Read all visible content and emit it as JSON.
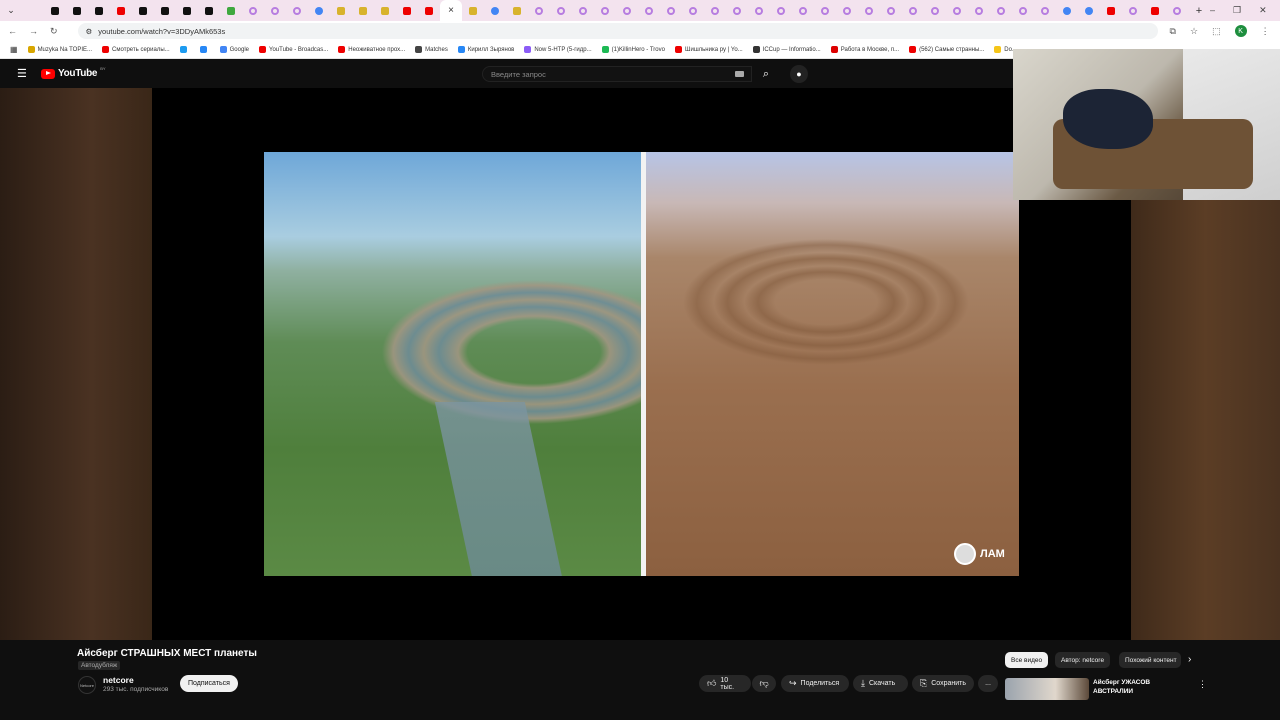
{
  "browser": {
    "url": "youtube.com/watch?v=3DDyAMk653s",
    "tabs": [
      {
        "icon": "chevron-down"
      },
      {
        "icon": "gear"
      },
      {
        "icon": "b"
      },
      {
        "icon": "b"
      },
      {
        "icon": "b"
      },
      {
        "icon": "r"
      },
      {
        "icon": "b"
      },
      {
        "icon": "b"
      },
      {
        "icon": "b"
      },
      {
        "icon": "b"
      },
      {
        "icon": "g"
      },
      {
        "icon": "p"
      },
      {
        "icon": "p"
      },
      {
        "icon": "p"
      },
      {
        "icon": "gg"
      },
      {
        "icon": "y"
      },
      {
        "icon": "y"
      },
      {
        "icon": "y"
      },
      {
        "icon": "r"
      },
      {
        "icon": "r"
      },
      {
        "icon": "close",
        "active": true
      },
      {
        "icon": "y"
      },
      {
        "icon": "gg"
      },
      {
        "icon": "y"
      },
      {
        "icon": "p"
      },
      {
        "icon": "p"
      },
      {
        "icon": "p"
      },
      {
        "icon": "p"
      },
      {
        "icon": "p"
      },
      {
        "icon": "p"
      },
      {
        "icon": "p"
      },
      {
        "icon": "p"
      },
      {
        "icon": "p"
      },
      {
        "icon": "p"
      },
      {
        "icon": "p"
      },
      {
        "icon": "p"
      },
      {
        "icon": "p"
      },
      {
        "icon": "p"
      },
      {
        "icon": "p"
      },
      {
        "icon": "p"
      },
      {
        "icon": "p"
      },
      {
        "icon": "p"
      },
      {
        "icon": "p"
      },
      {
        "icon": "p"
      },
      {
        "icon": "p"
      },
      {
        "icon": "p"
      },
      {
        "icon": "p"
      },
      {
        "icon": "p"
      },
      {
        "icon": "gg"
      },
      {
        "icon": "gg"
      },
      {
        "icon": "r"
      },
      {
        "icon": "p"
      },
      {
        "icon": "r"
      },
      {
        "icon": "p"
      }
    ],
    "new_tab": "+",
    "bookmarks": [
      {
        "label": "Muzyka Na TOPIE...",
        "color": "#d8a600"
      },
      {
        "label": "Смотреть сериалы...",
        "color": "#e00"
      },
      {
        "label": "",
        "color": "#1d9bf0"
      },
      {
        "label": "",
        "color": "#2787f5"
      },
      {
        "label": "Google",
        "color": "#4285f4"
      },
      {
        "label": "YouTube - Broadcas...",
        "color": "#e00"
      },
      {
        "label": "Неоживатное прох...",
        "color": "#e00"
      },
      {
        "label": "Matches",
        "color": "#444"
      },
      {
        "label": "Кирилл Зырянов",
        "color": "#2787f5"
      },
      {
        "label": "Now 5-HTP (5-гидр...",
        "color": "#8b5cf6"
      },
      {
        "label": "(1)KillinHero - Trovo",
        "color": "#1db954"
      },
      {
        "label": "Шишльника ру | Yo...",
        "color": "#e00"
      },
      {
        "label": "ICCup — Informatio...",
        "color": "#333"
      },
      {
        "label": "Работа в Москве, п...",
        "color": "#d00"
      },
      {
        "label": "(562) Самые странны...",
        "color": "#e00"
      },
      {
        "label": "Do...",
        "color": "#f5c518"
      }
    ]
  },
  "youtube": {
    "logo_text": "YouTube",
    "logo_country": "BY",
    "search_placeholder": "Введите запрос",
    "video": {
      "title": "Айсберг СТРАШНЫХ МЕСТ планеты",
      "dub_badge": "Автодубляж",
      "watermark": "ЛАМ"
    },
    "channel": {
      "avatar_text": "Netcore",
      "name": "netcore",
      "subscribers": "293 тыс. подписчиков",
      "subscribe_label": "Подписаться"
    },
    "actions": {
      "likes": "10 тыс.",
      "share": "Поделиться",
      "download": "Скачать",
      "save": "Сохранить",
      "more": "..."
    },
    "chips": {
      "all": "Все видео",
      "author": "Автор: netcore",
      "similar": "Похожий контент"
    },
    "recommendation": {
      "title": "Айсберг УЖАСОВ АВСТРАЛИИ"
    }
  }
}
